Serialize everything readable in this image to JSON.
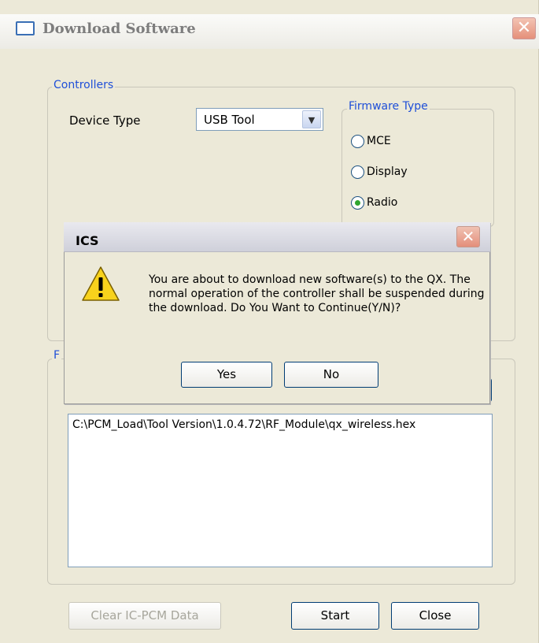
{
  "window": {
    "title": "Download Software",
    "close_glyph": "✕"
  },
  "controllers": {
    "legend": "Controllers",
    "device_type_label": "Device Type",
    "device_type_value": "USB Tool",
    "dropdown_glyph": "▼"
  },
  "firmware": {
    "legend": "Firmware Type",
    "options": [
      {
        "label": "MCE",
        "selected": false
      },
      {
        "label": "Display",
        "selected": false
      },
      {
        "label": "Radio",
        "selected": true
      }
    ]
  },
  "files": {
    "legend": "F",
    "paths": [
      "C:\\PCM_Load\\Tool Version\\1.0.4.72\\RF_Module\\qx_wireless.hex"
    ]
  },
  "buttons": {
    "clear": "Clear IC-PCM Data",
    "start": "Start",
    "close": "Close"
  },
  "dialog": {
    "title": "ICS",
    "close_glyph": "✕",
    "message": "You are about to download new software(s) to the QX. The normal operation of the controller shall be suspended during the download. Do You Want to Continue(Y/N)?",
    "yes": "Yes",
    "no": "No"
  },
  "colors": {
    "legend_blue": "#1f4fd8",
    "radio_selected": "#2fa52f",
    "warning_yellow": "#f8d21c"
  }
}
